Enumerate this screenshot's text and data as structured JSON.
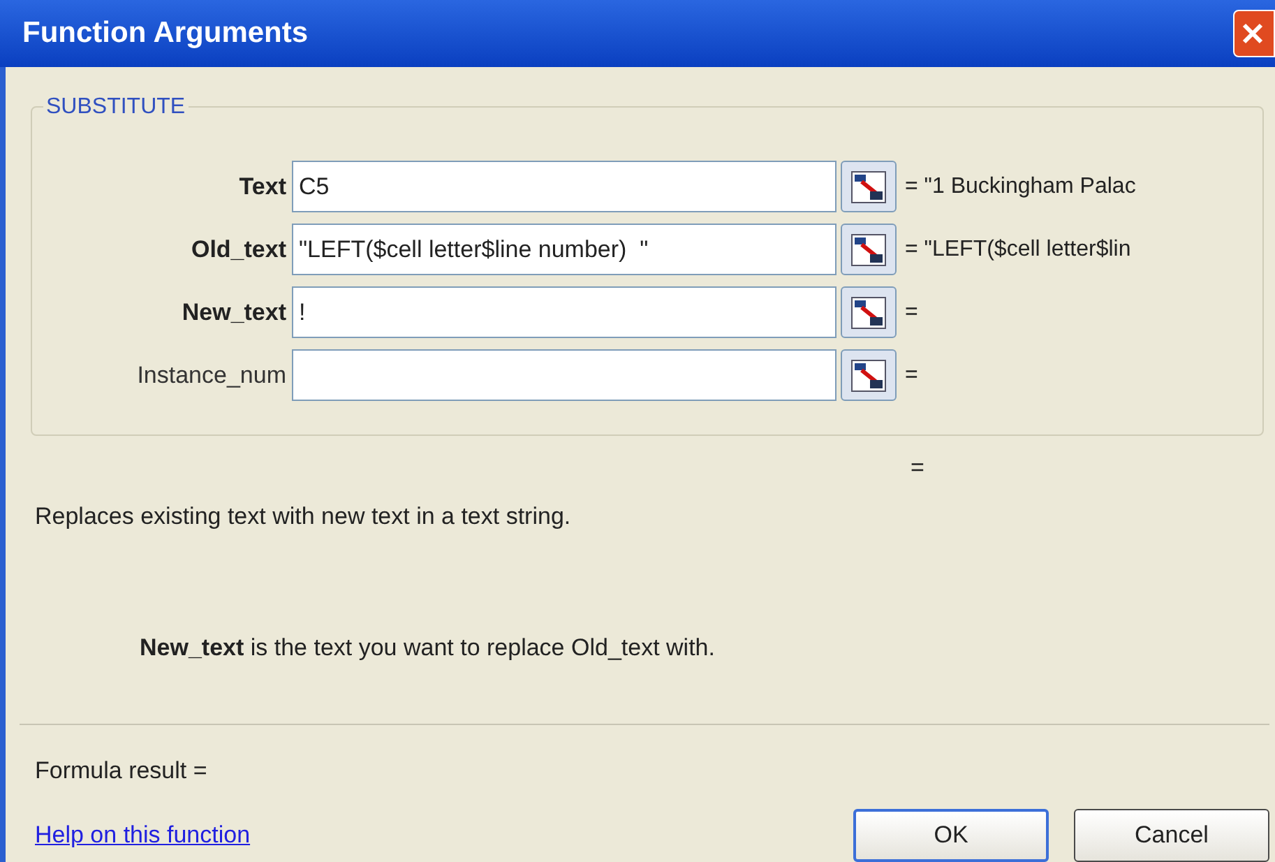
{
  "window": {
    "title": "Function Arguments"
  },
  "function_name": "SUBSTITUTE",
  "arguments": [
    {
      "label": "Text",
      "required": true,
      "value": "C5",
      "result": "= \"1 Buckingham Palac"
    },
    {
      "label": "Old_text",
      "required": true,
      "value": "\"LEFT($cell letter$line number)  \"",
      "result": "= \"LEFT($cell letter$lin"
    },
    {
      "label": "New_text",
      "required": true,
      "value": "!",
      "result": "="
    },
    {
      "label": "Instance_num",
      "required": false,
      "result": "="
    }
  ],
  "overall_result": "=",
  "description": "Replaces existing text with new text in a text string.",
  "argument_help": "**New_text** is the text you want to replace Old_text with.",
  "formula_result": "Formula result =",
  "help_link": "Help on this function",
  "buttons": [
    {
      "label": "OK",
      "default": true
    },
    {
      "label": "Cancel",
      "default": false
    }
  ]
}
